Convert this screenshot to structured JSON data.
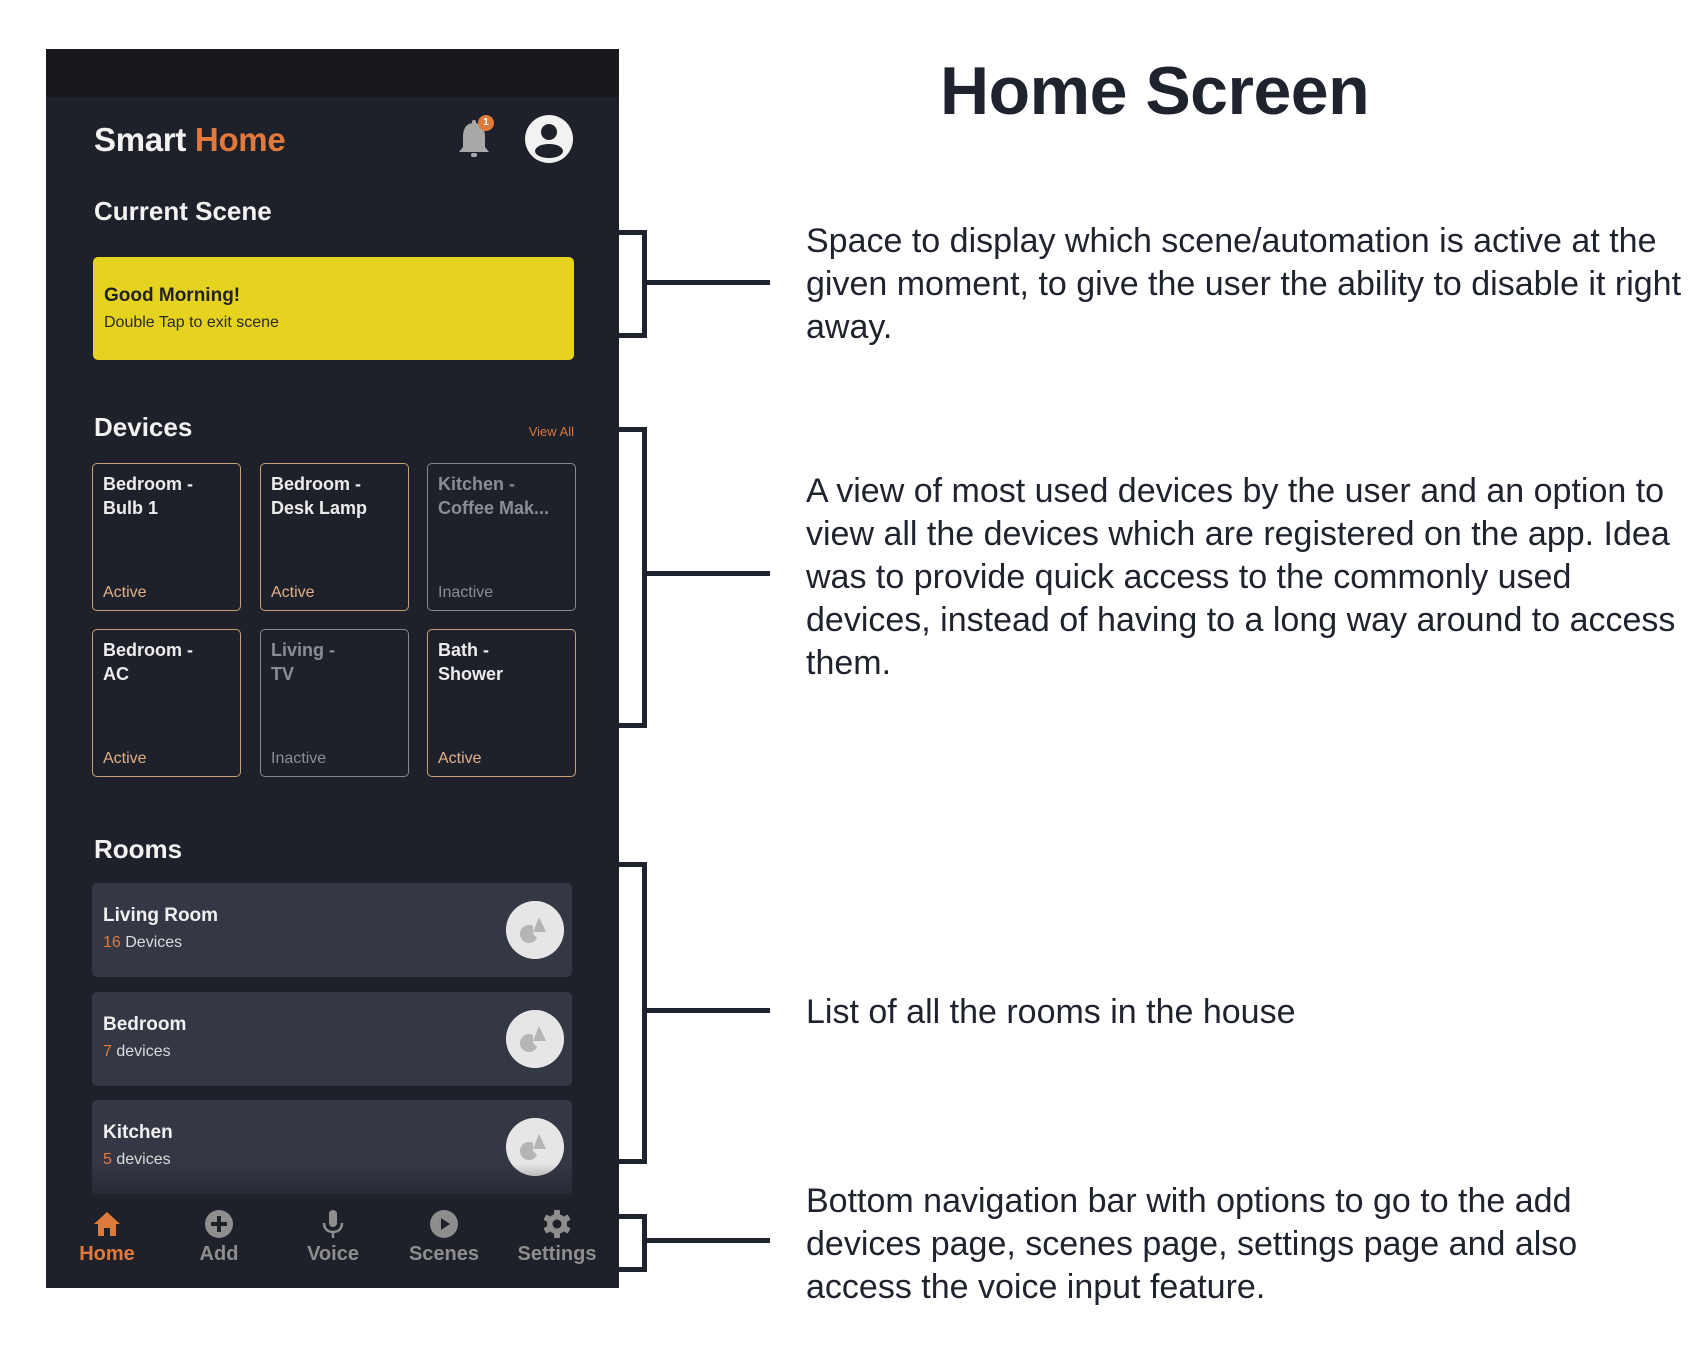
{
  "page_title": "Home Screen",
  "app": {
    "title_part1": "Smart",
    "title_part2": "Home",
    "notification_count": "1",
    "accent_color": "#e07a3c"
  },
  "current_scene": {
    "heading": "Current Scene",
    "title": "Good Morning!",
    "subtitle": "Double Tap to exit scene",
    "color": "#e6d31f"
  },
  "devices": {
    "heading": "Devices",
    "view_all": "View All",
    "items": [
      {
        "name": "Bedroom -\nBulb 1",
        "status": "Active"
      },
      {
        "name": "Bedroom -\nDesk Lamp",
        "status": "Active"
      },
      {
        "name": "Kitchen -\nCoffee Mak...",
        "status": "Inactive"
      },
      {
        "name": "Bedroom -\nAC",
        "status": "Active"
      },
      {
        "name": "Living -\nTV",
        "status": "Inactive"
      },
      {
        "name": "Bath -\nShower",
        "status": "Active"
      }
    ]
  },
  "rooms": {
    "heading": "Rooms",
    "items": [
      {
        "name": "Living Room",
        "count": "16",
        "unit": " Devices",
        "icon": "shapes-icon"
      },
      {
        "name": "Bedroom",
        "count": "7",
        "unit": " devices",
        "icon": "shapes-icon"
      },
      {
        "name": "Kitchen",
        "count": "5",
        "unit": " devices",
        "icon": "shapes-icon"
      }
    ]
  },
  "nav": {
    "items": [
      {
        "label": "Home",
        "icon": "home-icon",
        "active": true
      },
      {
        "label": "Add",
        "icon": "plus-circle-icon",
        "active": false
      },
      {
        "label": "Voice",
        "icon": "microphone-icon",
        "active": false
      },
      {
        "label": "Scenes",
        "icon": "play-circle-icon",
        "active": false
      },
      {
        "label": "Settings",
        "icon": "gear-icon",
        "active": false
      }
    ]
  },
  "annotations": {
    "scene": "Space to display which scene/automation is active at the given moment, to give the user the ability to disable it right away.",
    "devices": "A view of most used devices by the user and an option to view all the devices which are registered on the app. Idea was to provide quick access to the commonly used devices, instead of having to a long way around to access them.",
    "rooms": "List of all the rooms in the house",
    "nav": "Bottom navigation bar with options to go to the add devices page, scenes page, settings page and also access the voice input feature."
  }
}
